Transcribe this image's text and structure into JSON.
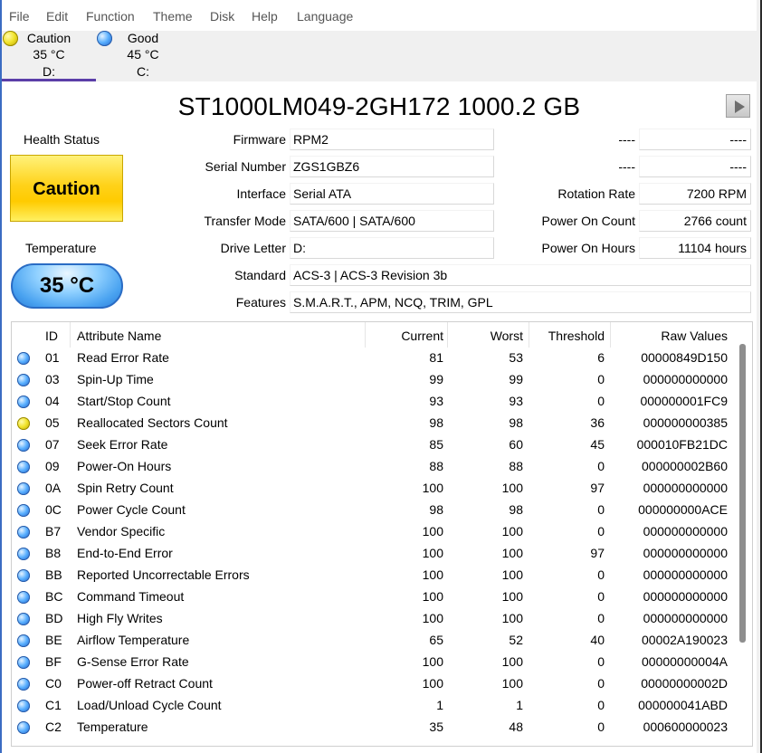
{
  "menu": [
    "File",
    "Edit",
    "Function",
    "Theme",
    "Disk",
    "Help",
    "Language"
  ],
  "drives": [
    {
      "status": "Caution",
      "temp": "35 °C",
      "letter": "D:",
      "color": "yellow"
    },
    {
      "status": "Good",
      "temp": "45 °C",
      "letter": "C:",
      "color": "blue"
    }
  ],
  "disk": {
    "title": "ST1000LM049-2GH172 1000.2 GB",
    "health_label": "Health Status",
    "health_value": "Caution",
    "temp_label": "Temperature",
    "temp_value": "35 °C",
    "firmware_label": "Firmware",
    "firmware": "RPM2",
    "serial_label": "Serial Number",
    "serial": "ZGS1GBZ6",
    "interface_label": "Interface",
    "interface": "Serial ATA",
    "transfer_label": "Transfer Mode",
    "transfer": "SATA/600 | SATA/600",
    "letter_label": "Drive Letter",
    "letter": "D:",
    "standard_label": "Standard",
    "standard": "ACS-3 | ACS-3 Revision 3b",
    "features_label": "Features",
    "features": "S.M.A.R.T., APM, NCQ, TRIM, GPL",
    "blank1_label": "----",
    "blank1_value": "----",
    "blank2_label": "----",
    "blank2_value": "----",
    "rotation_label": "Rotation Rate",
    "rotation": "7200 RPM",
    "poweron_count_label": "Power On Count",
    "poweron_count": "2766 count",
    "poweron_hours_label": "Power On Hours",
    "poweron_hours": "11104 hours"
  },
  "smart": {
    "headers": {
      "id": "ID",
      "name": "Attribute Name",
      "current": "Current",
      "worst": "Worst",
      "threshold": "Threshold",
      "raw": "Raw Values"
    },
    "rows": [
      {
        "status": "blue",
        "id": "01",
        "name": "Read Error Rate",
        "current": "81",
        "worst": "53",
        "threshold": "6",
        "raw": "00000849D150"
      },
      {
        "status": "blue",
        "id": "03",
        "name": "Spin-Up Time",
        "current": "99",
        "worst": "99",
        "threshold": "0",
        "raw": "000000000000"
      },
      {
        "status": "blue",
        "id": "04",
        "name": "Start/Stop Count",
        "current": "93",
        "worst": "93",
        "threshold": "0",
        "raw": "000000001FC9"
      },
      {
        "status": "yellow",
        "id": "05",
        "name": "Reallocated Sectors Count",
        "current": "98",
        "worst": "98",
        "threshold": "36",
        "raw": "000000000385"
      },
      {
        "status": "blue",
        "id": "07",
        "name": "Seek Error Rate",
        "current": "85",
        "worst": "60",
        "threshold": "45",
        "raw": "000010FB21DC"
      },
      {
        "status": "blue",
        "id": "09",
        "name": "Power-On Hours",
        "current": "88",
        "worst": "88",
        "threshold": "0",
        "raw": "000000002B60"
      },
      {
        "status": "blue",
        "id": "0A",
        "name": "Spin Retry Count",
        "current": "100",
        "worst": "100",
        "threshold": "97",
        "raw": "000000000000"
      },
      {
        "status": "blue",
        "id": "0C",
        "name": "Power Cycle Count",
        "current": "98",
        "worst": "98",
        "threshold": "0",
        "raw": "000000000ACE"
      },
      {
        "status": "blue",
        "id": "B7",
        "name": "Vendor Specific",
        "current": "100",
        "worst": "100",
        "threshold": "0",
        "raw": "000000000000"
      },
      {
        "status": "blue",
        "id": "B8",
        "name": "End-to-End Error",
        "current": "100",
        "worst": "100",
        "threshold": "97",
        "raw": "000000000000"
      },
      {
        "status": "blue",
        "id": "BB",
        "name": "Reported Uncorrectable Errors",
        "current": "100",
        "worst": "100",
        "threshold": "0",
        "raw": "000000000000"
      },
      {
        "status": "blue",
        "id": "BC",
        "name": "Command Timeout",
        "current": "100",
        "worst": "100",
        "threshold": "0",
        "raw": "000000000000"
      },
      {
        "status": "blue",
        "id": "BD",
        "name": "High Fly Writes",
        "current": "100",
        "worst": "100",
        "threshold": "0",
        "raw": "000000000000"
      },
      {
        "status": "blue",
        "id": "BE",
        "name": "Airflow Temperature",
        "current": "65",
        "worst": "52",
        "threshold": "40",
        "raw": "00002A190023"
      },
      {
        "status": "blue",
        "id": "BF",
        "name": "G-Sense Error Rate",
        "current": "100",
        "worst": "100",
        "threshold": "0",
        "raw": "00000000004A"
      },
      {
        "status": "blue",
        "id": "C0",
        "name": "Power-off Retract Count",
        "current": "100",
        "worst": "100",
        "threshold": "0",
        "raw": "00000000002D"
      },
      {
        "status": "blue",
        "id": "C1",
        "name": "Load/Unload Cycle Count",
        "current": "1",
        "worst": "1",
        "threshold": "0",
        "raw": "000000041ABD"
      },
      {
        "status": "blue",
        "id": "C2",
        "name": "Temperature",
        "current": "35",
        "worst": "48",
        "threshold": "0",
        "raw": "000600000023"
      }
    ]
  }
}
